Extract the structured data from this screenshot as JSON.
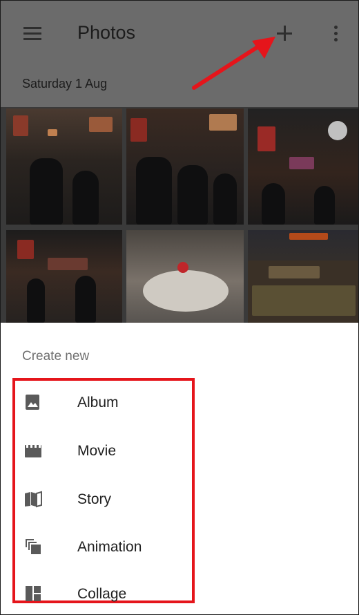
{
  "app_bar": {
    "title": "Photos",
    "menu_icon": "hamburger-menu-icon",
    "add_icon": "plus-icon",
    "overflow_icon": "more-vert-icon",
    "scrim_color": "#6b6b6b"
  },
  "date_header": "Saturday 1 Aug",
  "sheet": {
    "title": "Create new",
    "highlight_color": "#e5151b",
    "items": [
      {
        "label": "Album",
        "icon": "album-icon"
      },
      {
        "label": "Movie",
        "icon": "movie-icon"
      },
      {
        "label": "Story",
        "icon": "story-icon"
      },
      {
        "label": "Animation",
        "icon": "animation-icon"
      },
      {
        "label": "Collage",
        "icon": "collage-icon"
      }
    ]
  },
  "annotation": {
    "arrow_color": "#e5151b"
  }
}
